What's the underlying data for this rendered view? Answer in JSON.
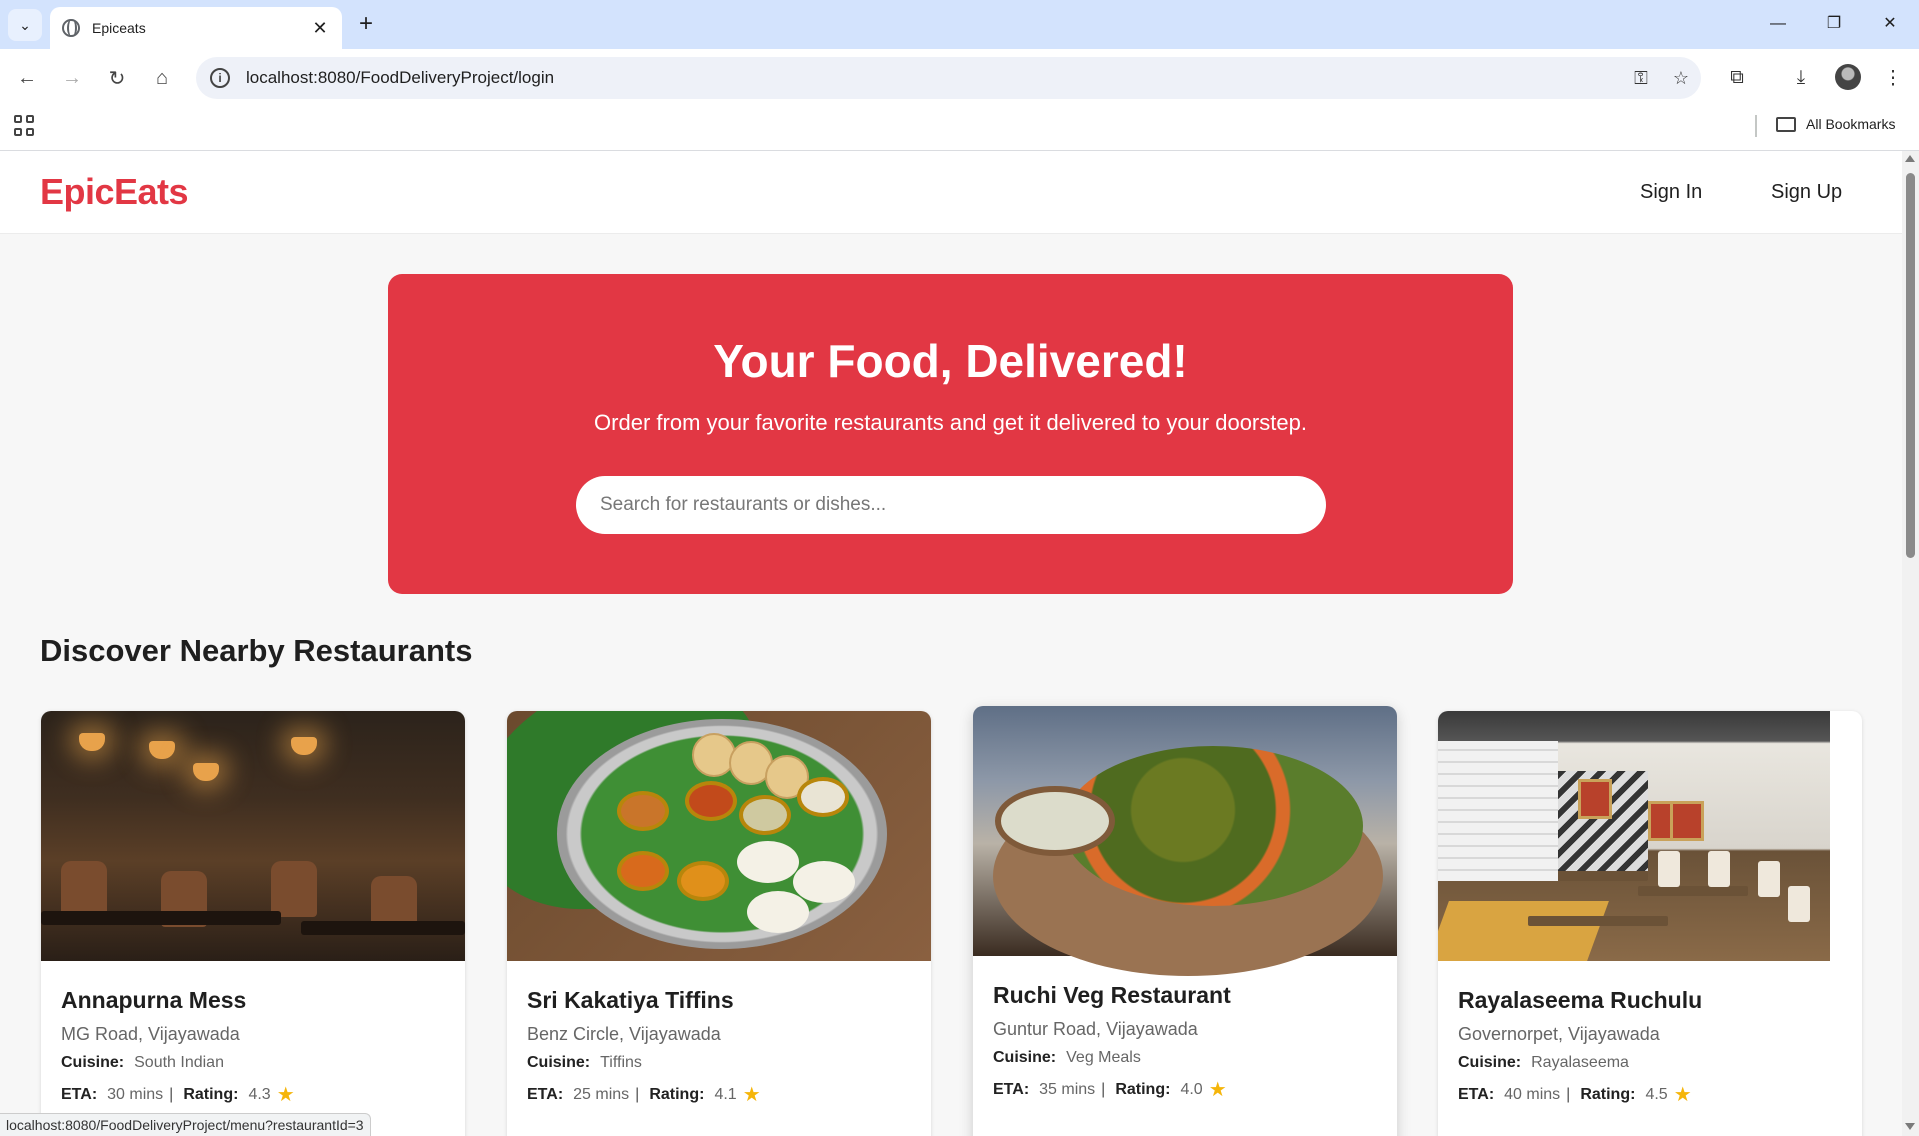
{
  "browser": {
    "tab_title": "Epiceats",
    "url": "localhost:8080/FoodDeliveryProject/login",
    "bookmarks_label": "All Bookmarks",
    "status_url": "localhost:8080/FoodDeliveryProject/menu?restaurantId=3"
  },
  "site": {
    "brand": "EpicEats",
    "brand_color": "#e23744",
    "nav": {
      "sign_in": "Sign In",
      "sign_up": "Sign Up"
    }
  },
  "hero": {
    "title": "Your Food, Delivered!",
    "subtitle": "Order from your favorite restaurants and get it delivered to your doorstep.",
    "search_placeholder": "Search for restaurants or dishes..."
  },
  "section_title": "Discover Nearby Restaurants",
  "labels": {
    "cuisine": "Cuisine:",
    "eta": "ETA:",
    "rating": "Rating:"
  },
  "restaurants": [
    {
      "name": "Annapurna Mess",
      "location": "MG Road, Vijayawada",
      "cuisine": "South Indian",
      "eta": "30 mins",
      "rating": "4.3"
    },
    {
      "name": "Sri Kakatiya Tiffins",
      "location": "Benz Circle, Vijayawada",
      "cuisine": "Tiffins",
      "eta": "25 mins",
      "rating": "4.1"
    },
    {
      "name": "Ruchi Veg Restaurant",
      "location": "Guntur Road, Vijayawada",
      "cuisine": "Veg Meals",
      "eta": "35 mins",
      "rating": "4.0"
    },
    {
      "name": "Rayalaseema Ruchulu",
      "location": "Governorpet, Vijayawada",
      "cuisine": "Rayalaseema",
      "eta": "40 mins",
      "rating": "4.5"
    }
  ]
}
